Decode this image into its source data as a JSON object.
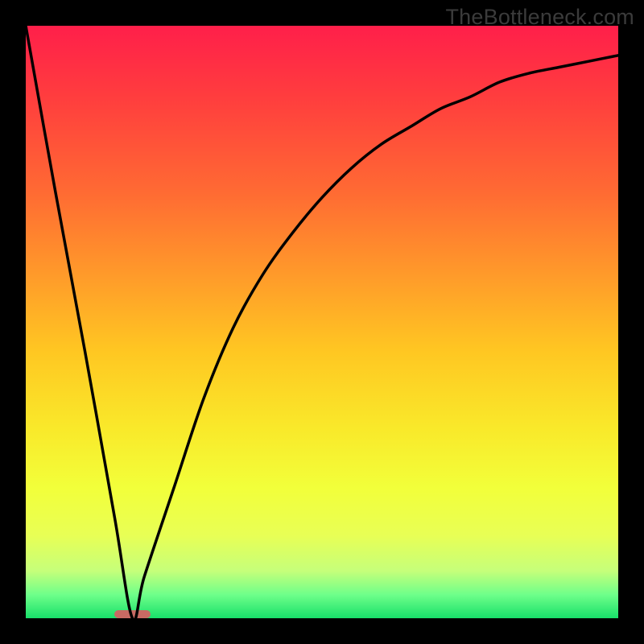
{
  "watermark": "TheBottleneck.com",
  "colors": {
    "frame": "#000000",
    "curve": "#000000",
    "footprint": "#c86a63",
    "gradient_stops": [
      {
        "pct": 0,
        "hex": "#ff1f4a"
      },
      {
        "pct": 12,
        "hex": "#ff3d3e"
      },
      {
        "pct": 28,
        "hex": "#ff6a33"
      },
      {
        "pct": 42,
        "hex": "#ff9a2a"
      },
      {
        "pct": 55,
        "hex": "#ffc722"
      },
      {
        "pct": 68,
        "hex": "#f9e92a"
      },
      {
        "pct": 78,
        "hex": "#f2ff3a"
      },
      {
        "pct": 86,
        "hex": "#e8ff55"
      },
      {
        "pct": 92,
        "hex": "#c6ff7a"
      },
      {
        "pct": 96,
        "hex": "#6fff8a"
      },
      {
        "pct": 100,
        "hex": "#18e06a"
      }
    ]
  },
  "chart_data": {
    "type": "line",
    "title": "",
    "xlabel": "",
    "ylabel": "",
    "xlim": [
      0,
      100
    ],
    "ylim": [
      0,
      100
    ],
    "footprint_marker_x": [
      15,
      21
    ],
    "curve": {
      "x": [
        0,
        5,
        10,
        15,
        18,
        20,
        25,
        30,
        35,
        40,
        45,
        50,
        55,
        60,
        65,
        70,
        75,
        80,
        85,
        90,
        95,
        100
      ],
      "values": [
        100,
        72,
        45,
        17,
        0,
        7,
        22,
        37,
        49,
        58,
        65,
        71,
        76,
        80,
        83,
        86,
        88,
        90.5,
        92,
        93,
        94,
        95
      ]
    }
  }
}
